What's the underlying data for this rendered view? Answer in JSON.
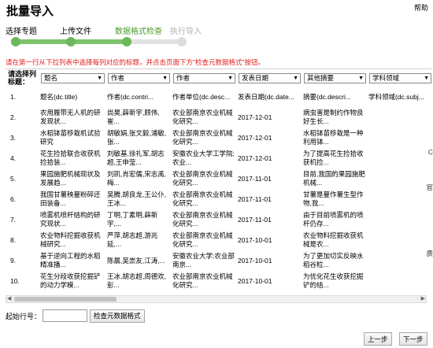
{
  "page": {
    "title": "批量导入",
    "help": "帮助"
  },
  "steps": [
    {
      "label": "选择专题",
      "state": "done"
    },
    {
      "label": "上传文件",
      "state": "done"
    },
    {
      "label": "数据格式检查",
      "state": "active"
    },
    {
      "label": "执行导入",
      "state": "todo"
    }
  ],
  "progress": {
    "completed_steps": 3,
    "total_steps": 4
  },
  "instruction": "请在第一行从下拉列表中选择每列对应的标题，并点击页面下方\"检查元数据格式\"按钮。",
  "table": {
    "corner_label": "请选择列标题：",
    "column_selects": [
      "题名",
      "作者",
      "作者",
      "发表日期",
      "其他摘要",
      "学科领域"
    ],
    "rows": [
      {
        "num": "1.",
        "cells": [
          "题名(dc.title)",
          "作者(dc.contri...",
          "作者单位(dc.desc...",
          "发表日期(dc.date...",
          "摘要(dc.descri...",
          "学科领域(dc.subj..."
        ]
      },
      {
        "num": "2.",
        "cells": [
          "农用履带无人机的研发现状...",
          "尚昊,薛新宇,顾伟,崔...",
          "农业部南京农业机械化研究...",
          "2017-12-01",
          "病虫害是制约作物良好生长...",
          ""
        ]
      },
      {
        "num": "3.",
        "cells": [
          "水稻钵苗移栽机试验研究",
          "胡敏娟,张文毅,浦敏,张...",
          "农业部南京农业机械化研究...",
          "2017-12-01",
          "水稻钵苗移栽是一种利用钵...",
          ""
        ]
      },
      {
        "num": "4.",
        "cells": [
          "花生捡拾联合收获机捡拾装...",
          "刘敏基,徐礼军,胡志超,王申莹...",
          "安徽农业大学工学院;农业...",
          "2017-12-01",
          "为了提高花生捡拾收获机捡...",
          ""
        ]
      },
      {
        "num": "5.",
        "cells": [
          "果园施肥机械现状及发展趋...",
          "刘凯,肖宏儒,宋志禹,梅...",
          "农业部南京农业机械化研究...",
          "2017-11-01",
          "目前,我国的果园施肥机械...",
          ""
        ]
      },
      {
        "num": "6.",
        "cells": [
          "我国甘薯秧蔓粉碎还田装备...",
          "吴腾,胡良龙,王公仆,王冰...",
          "农业部南京农业机械化研究...",
          "2017-11-01",
          "甘薯是蔓作薯生型作物,我...",
          ""
        ]
      },
      {
        "num": "7.",
        "cells": [
          "喷雾机喷杆结构的研究现状...",
          "丁明,丁素明,薛新宇,...",
          "农业部南京农业机械化研究...",
          "2017-11-01",
          "由于目前喷雾机的喷杆仍存...",
          ""
        ]
      },
      {
        "num": "8.",
        "cells": [
          "农业物料挖掘收获机械研究...",
          "严萍,胡志超,游兆延,...",
          "农业部南京农业机械化研究...",
          "2017-10-01",
          "农业物料挖掘收获机械是农...",
          ""
        ]
      },
      {
        "num": "9.",
        "cells": [
          "基于逆向工程的水稻精准播...",
          "陈晨,吴崇友,江涛,...",
          "安徽农业大学;农业部南京...",
          "2017-10-01",
          "为了更加切实反映水稻谷粒...",
          ""
        ]
      },
      {
        "num": "10.",
        "cells": [
          "花生分段收获挖掘铲的动力学模...",
          "王冰,胡志超,周德欢,彭...",
          "农业部南京农业机械化研究...",
          "2017-10-01",
          "为优化花生收获挖掘铲的结...",
          ""
        ]
      }
    ]
  },
  "side_chars": [
    "C",
    "官",
    "质"
  ],
  "start_row": {
    "label": "起始行号：",
    "value": ""
  },
  "buttons": {
    "check": "检查元数据格式",
    "prev": "上一步",
    "next": "下一步"
  }
}
